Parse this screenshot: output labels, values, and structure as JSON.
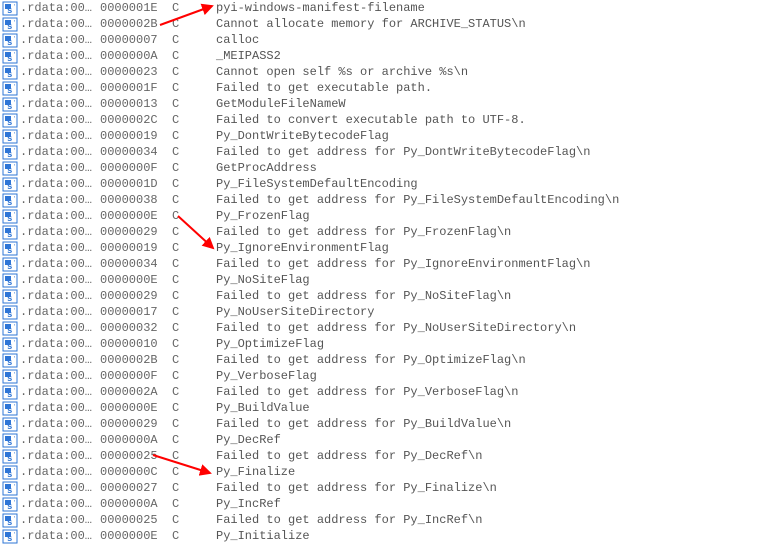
{
  "columns": {
    "section_prefix": ".rdata:00…",
    "type_code": "C"
  },
  "rows": [
    {
      "length": "0000001E",
      "str": "pyi-windows-manifest-filename"
    },
    {
      "length": "0000002B",
      "str": "Cannot allocate memory for ARCHIVE_STATUS\\n"
    },
    {
      "length": "00000007",
      "str": "calloc"
    },
    {
      "length": "0000000A",
      "str": "_MEIPASS2"
    },
    {
      "length": "00000023",
      "str": "Cannot open self %s or archive %s\\n"
    },
    {
      "length": "0000001F",
      "str": "Failed to get executable path."
    },
    {
      "length": "00000013",
      "str": "GetModuleFileNameW"
    },
    {
      "length": "0000002C",
      "str": "Failed to convert executable path to UTF-8."
    },
    {
      "length": "00000019",
      "str": "Py_DontWriteBytecodeFlag"
    },
    {
      "length": "00000034",
      "str": "Failed to get address for Py_DontWriteBytecodeFlag\\n"
    },
    {
      "length": "0000000F",
      "str": "GetProcAddress"
    },
    {
      "length": "0000001D",
      "str": "Py_FileSystemDefaultEncoding"
    },
    {
      "length": "00000038",
      "str": "Failed to get address for Py_FileSystemDefaultEncoding\\n"
    },
    {
      "length": "0000000E",
      "str": "Py_FrozenFlag"
    },
    {
      "length": "00000029",
      "str": "Failed to get address for Py_FrozenFlag\\n"
    },
    {
      "length": "00000019",
      "str": "Py_IgnoreEnvironmentFlag"
    },
    {
      "length": "00000034",
      "str": "Failed to get address for Py_IgnoreEnvironmentFlag\\n"
    },
    {
      "length": "0000000E",
      "str": "Py_NoSiteFlag"
    },
    {
      "length": "00000029",
      "str": "Failed to get address for Py_NoSiteFlag\\n"
    },
    {
      "length": "00000017",
      "str": "Py_NoUserSiteDirectory"
    },
    {
      "length": "00000032",
      "str": "Failed to get address for Py_NoUserSiteDirectory\\n"
    },
    {
      "length": "00000010",
      "str": "Py_OptimizeFlag"
    },
    {
      "length": "0000002B",
      "str": "Failed to get address for Py_OptimizeFlag\\n"
    },
    {
      "length": "0000000F",
      "str": "Py_VerboseFlag"
    },
    {
      "length": "0000002A",
      "str": "Failed to get address for Py_VerboseFlag\\n"
    },
    {
      "length": "0000000E",
      "str": "Py_BuildValue"
    },
    {
      "length": "00000029",
      "str": "Failed to get address for Py_BuildValue\\n"
    },
    {
      "length": "0000000A",
      "str": "Py_DecRef"
    },
    {
      "length": "00000025",
      "str": "Failed to get address for Py_DecRef\\n"
    },
    {
      "length": "0000000C",
      "str": "Py_Finalize"
    },
    {
      "length": "00000027",
      "str": "Failed to get address for Py_Finalize\\n"
    },
    {
      "length": "0000000A",
      "str": "Py_IncRef"
    },
    {
      "length": "00000025",
      "str": "Failed to get address for Py_IncRef\\n"
    },
    {
      "length": "0000000E",
      "str": "Py_Initialize"
    }
  ]
}
